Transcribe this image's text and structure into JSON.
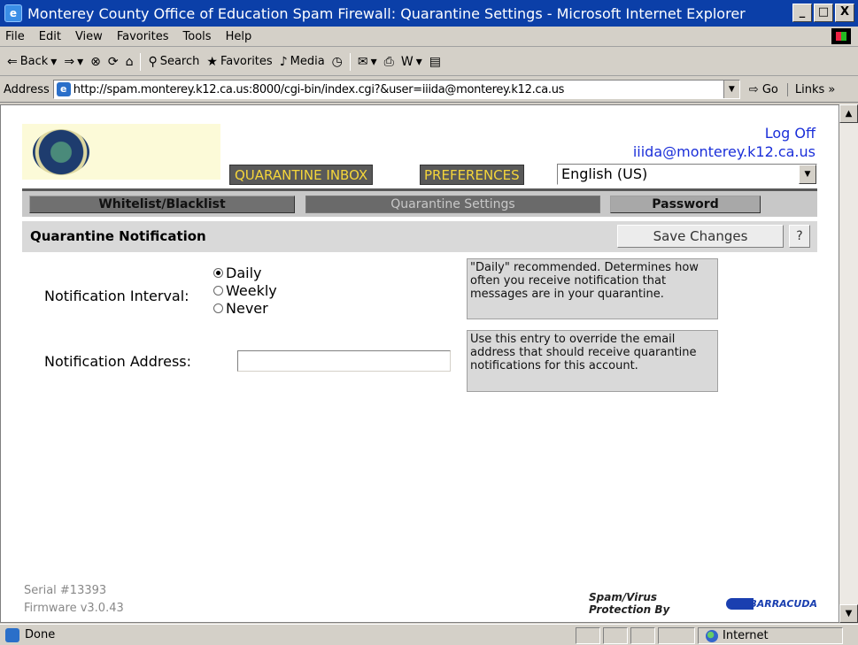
{
  "window": {
    "title": "Monterey County Office of Education Spam Firewall: Quarantine Settings - Microsoft Internet Explorer",
    "minimize": "_",
    "maximize": "□",
    "close": "X"
  },
  "menu": [
    "File",
    "Edit",
    "View",
    "Favorites",
    "Tools",
    "Help"
  ],
  "toolbar": {
    "back": "Back",
    "search": "Search",
    "favorites": "Favorites",
    "media": "Media"
  },
  "address": {
    "label": "Address",
    "url": "http://spam.monterey.k12.ca.us:8000/cgi-bin/index.cgi?&user=iiida@monterey.k12.ca.us",
    "go": "Go",
    "links": "Links"
  },
  "header": {
    "log_off": "Log Off",
    "user_email": "iiida@monterey.k12.ca.us",
    "tab_quarantine_inbox": "QUARANTINE INBOX",
    "tab_preferences": "PREFERENCES",
    "language": "English (US)"
  },
  "subnav": {
    "whitelist": "Whitelist/Blacklist",
    "quarantine_settings": "Quarantine Settings",
    "password": "Password"
  },
  "section": {
    "title": "Quarantine Notification",
    "save_label": "Save Changes",
    "help_label": "?"
  },
  "form": {
    "interval_label": "Notification Interval:",
    "interval_options": [
      "Daily",
      "Weekly",
      "Never"
    ],
    "interval_selected": "Daily",
    "interval_help": "\"Daily\" recommended. Determines how often you receive notification that messages are in your quarantine.",
    "address_label": "Notification Address:",
    "address_value": "",
    "address_help": "Use this entry to override the email address that should receive quarantine notifications for this account."
  },
  "footer": {
    "serial": "Serial #13393",
    "firmware": "Firmware v3.0.43",
    "protection": "Spam/Virus Protection By",
    "brand": "BARRACUDA"
  },
  "status": {
    "text": "Done",
    "zone": "Internet"
  }
}
